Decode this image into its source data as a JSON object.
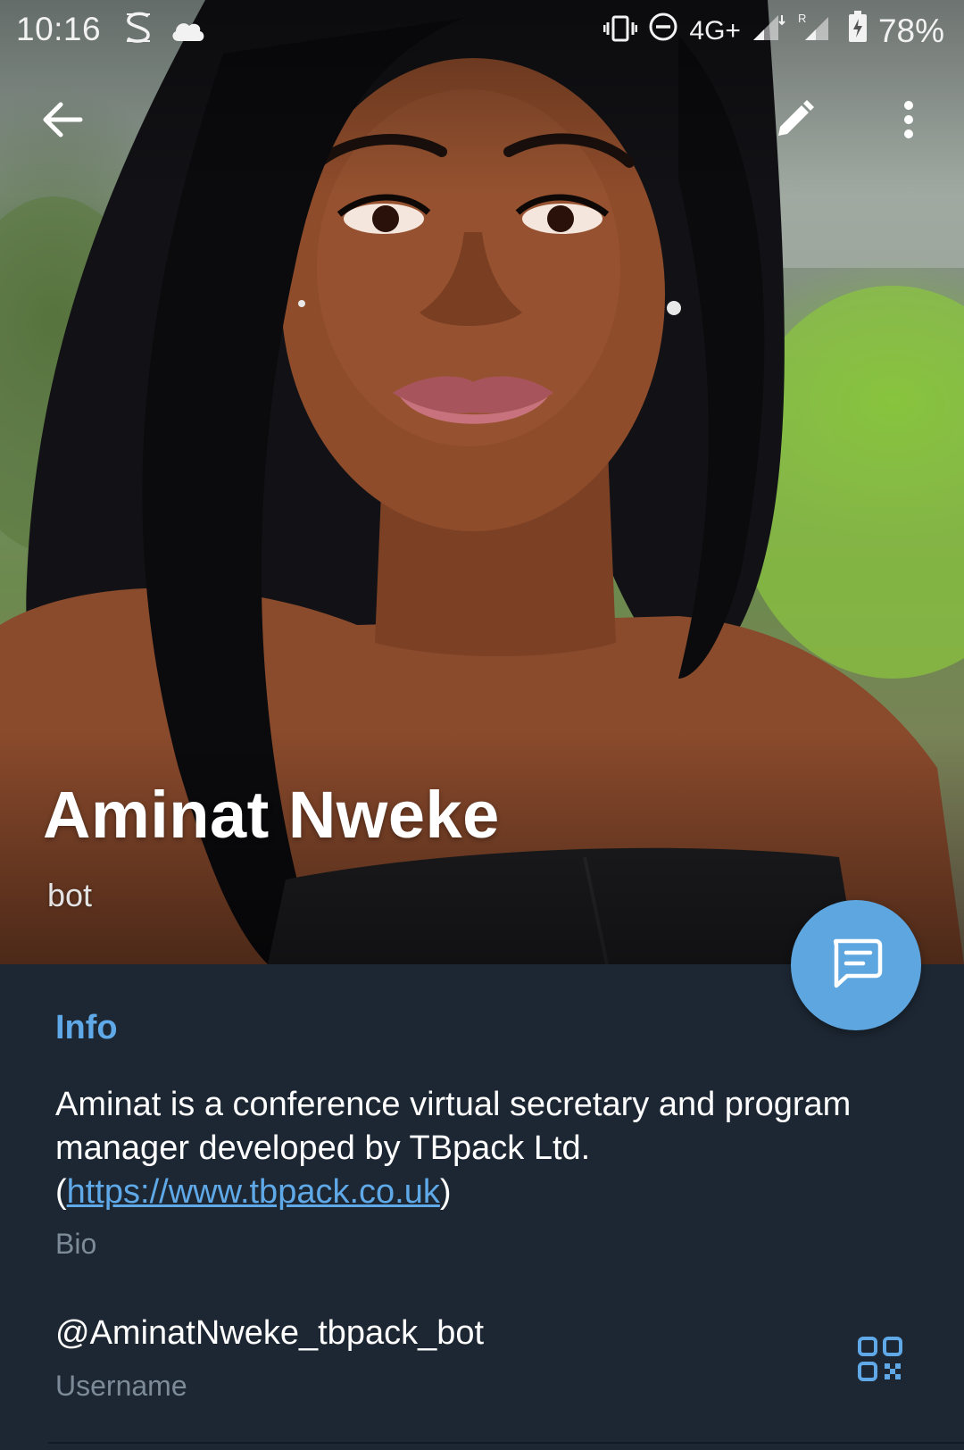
{
  "status_bar": {
    "time": "10:16",
    "network_type": "4G+",
    "battery": "78%",
    "left_icons": [
      "stylus-s-icon",
      "cloud-icon"
    ],
    "right_icons": [
      "vibrate-icon",
      "do-not-disturb-icon",
      "signal-icon",
      "signal-roaming-icon",
      "battery-charging-icon"
    ]
  },
  "toolbar": {
    "back_icon": "arrow-left-icon",
    "edit_icon": "pencil-icon",
    "more_icon": "more-vertical-icon"
  },
  "profile": {
    "name": "Aminat Nweke",
    "status": "bot"
  },
  "fab": {
    "icon": "message-icon"
  },
  "info": {
    "section_title": "Info",
    "bio_text_before": "Aminat is a conference virtual secretary and program manager developed by TBpack Ltd. (",
    "bio_link": "https://www.tbpack.co.uk",
    "bio_text_after": ")",
    "bio_label": "Bio",
    "username": "@AminatNweke_tbpack_bot",
    "username_label": "Username",
    "qr_icon": "qr-code-icon"
  },
  "colors": {
    "accent": "#5fa9e8",
    "fab": "#5ea6e0",
    "panel_bg": "#1d2733",
    "secondary_text": "#7d8b99"
  }
}
